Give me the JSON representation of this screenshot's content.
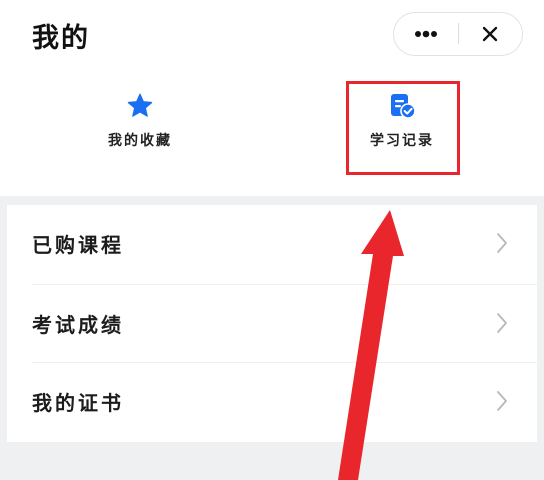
{
  "page": {
    "title": "我的"
  },
  "capsule": {
    "more_icon": "more-dots-icon",
    "close_icon": "close-icon"
  },
  "shortcuts": [
    {
      "label": "我的收藏",
      "icon": "star-icon",
      "color": "#1a6ff2"
    },
    {
      "label": "学习记录",
      "icon": "study-record-icon",
      "color": "#1a6ff2"
    }
  ],
  "menu": [
    {
      "label": "已购课程"
    },
    {
      "label": "考试成绩"
    },
    {
      "label": "我的证书"
    }
  ],
  "annotation": {
    "color": "#e8262c"
  }
}
